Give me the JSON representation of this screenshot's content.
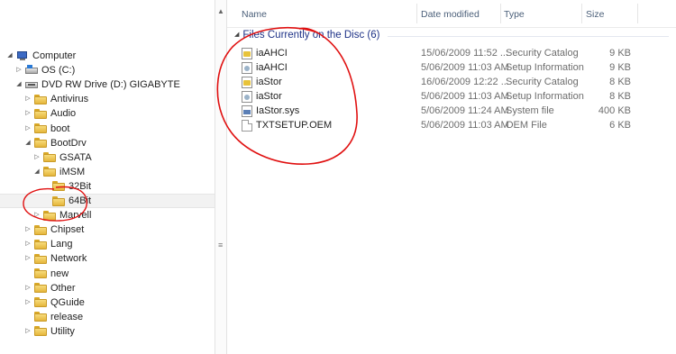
{
  "nav": {
    "items": [
      {
        "label": "Computer",
        "twisty": "◢",
        "icon": "computer-icon",
        "kind": "comp",
        "indent": 0
      },
      {
        "label": "OS (C:)",
        "twisty": "▷",
        "icon": "hard-drive-icon",
        "kind": "hdd",
        "indent": 1
      },
      {
        "label": "DVD RW Drive (D:) GIGABYTE",
        "twisty": "◢",
        "icon": "dvd-drive-icon",
        "kind": "dvd",
        "indent": 1
      },
      {
        "label": "Antivirus",
        "twisty": "▷",
        "icon": "folder-icon",
        "kind": "folder",
        "indent": 2
      },
      {
        "label": "Audio",
        "twisty": "▷",
        "icon": "folder-icon",
        "kind": "folder",
        "indent": 2
      },
      {
        "label": "boot",
        "twisty": "▷",
        "icon": "folder-icon",
        "kind": "folder",
        "indent": 2
      },
      {
        "label": "BootDrv",
        "twisty": "◢",
        "icon": "folder-icon",
        "kind": "folder",
        "indent": 2
      },
      {
        "label": "GSATA",
        "twisty": "▷",
        "icon": "folder-icon",
        "kind": "folder",
        "indent": 3
      },
      {
        "label": "iMSM",
        "twisty": "◢",
        "icon": "folder-icon",
        "kind": "folder",
        "indent": 3
      },
      {
        "label": "32Bit",
        "twisty": "",
        "icon": "folder-icon",
        "kind": "folder",
        "indent": 4
      },
      {
        "label": "64Bit",
        "twisty": "",
        "icon": "folder-icon",
        "kind": "folder",
        "indent": 4,
        "selected": true
      },
      {
        "label": "Marvell",
        "twisty": "▷",
        "icon": "folder-icon",
        "kind": "folder",
        "indent": 3
      },
      {
        "label": "Chipset",
        "twisty": "▷",
        "icon": "folder-icon",
        "kind": "folder",
        "indent": 2
      },
      {
        "label": "Lang",
        "twisty": "▷",
        "icon": "folder-icon",
        "kind": "folder",
        "indent": 2
      },
      {
        "label": "Network",
        "twisty": "▷",
        "icon": "folder-icon",
        "kind": "folder",
        "indent": 2
      },
      {
        "label": "new",
        "twisty": "",
        "icon": "folder-icon",
        "kind": "folder",
        "indent": 2
      },
      {
        "label": "Other",
        "twisty": "▷",
        "icon": "folder-icon",
        "kind": "folder",
        "indent": 2
      },
      {
        "label": "QGuide",
        "twisty": "▷",
        "icon": "folder-icon",
        "kind": "folder",
        "indent": 2
      },
      {
        "label": "release",
        "twisty": "",
        "icon": "folder-icon",
        "kind": "folder",
        "indent": 2
      },
      {
        "label": "Utility",
        "twisty": "▷",
        "icon": "folder-icon",
        "kind": "folder",
        "indent": 2
      }
    ]
  },
  "columns": {
    "name": "Name",
    "date": "Date modified",
    "type": "Type",
    "size": "Size"
  },
  "group": {
    "label": "Files Currently on the Disc (6)",
    "arrow": "◢"
  },
  "files": [
    {
      "name": "iaAHCI",
      "date": "15/06/2009 11:52 ...",
      "type": "Security Catalog",
      "size": "9 KB",
      "icon": "security-catalog-icon",
      "kind": "cat"
    },
    {
      "name": "iaAHCI",
      "date": "5/06/2009 11:03 AM",
      "type": "Setup Information",
      "size": "9 KB",
      "icon": "setup-information-icon",
      "kind": "inf"
    },
    {
      "name": "iaStor",
      "date": "16/06/2009 12:22 ...",
      "type": "Security Catalog",
      "size": "8 KB",
      "icon": "security-catalog-icon",
      "kind": "cat"
    },
    {
      "name": "iaStor",
      "date": "5/06/2009 11:03 AM",
      "type": "Setup Information",
      "size": "8 KB",
      "icon": "setup-information-icon",
      "kind": "inf"
    },
    {
      "name": "IaStor.sys",
      "date": "5/06/2009 11:24 AM",
      "type": "System file",
      "size": "400 KB",
      "icon": "system-file-icon",
      "kind": "sys"
    },
    {
      "name": "TXTSETUP.OEM",
      "date": "5/06/2009 11:03 AM",
      "type": "OEM File",
      "size": "6 KB",
      "icon": "oem-file-icon",
      "kind": "oem"
    }
  ],
  "splitter": {
    "grip": "≡",
    "up": "▲"
  },
  "annotation_color": "#e01010"
}
